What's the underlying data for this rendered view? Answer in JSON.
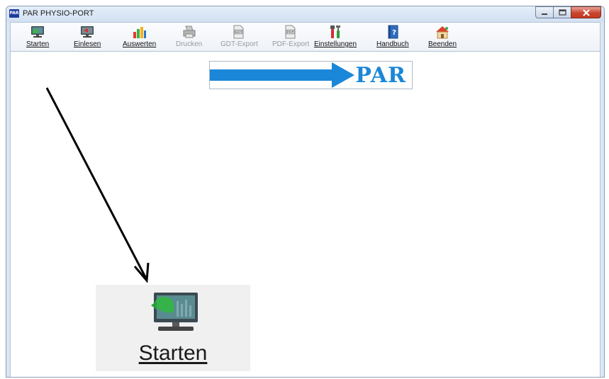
{
  "window": {
    "title": "PAR  PHYSIO-PORT",
    "app_icon_text": "PAR"
  },
  "toolbar": {
    "items": [
      {
        "label": "Starten",
        "icon": "monitor-start-icon",
        "enabled": true
      },
      {
        "label": "Einlesen",
        "icon": "monitor-read-icon",
        "enabled": true
      },
      {
        "label": "Auswerten",
        "icon": "bar-chart-icon",
        "enabled": true
      },
      {
        "label": "Drucken",
        "icon": "printer-icon",
        "enabled": false
      },
      {
        "label": "GDT-Export",
        "icon": "gdt-export-icon",
        "enabled": false
      },
      {
        "label": "PDF-Export",
        "icon": "pdf-export-icon",
        "enabled": false
      },
      {
        "label": "Einstellungen",
        "icon": "tools-icon",
        "enabled": true
      },
      {
        "label": "Handbuch",
        "icon": "manual-book-icon",
        "enabled": true
      },
      {
        "label": "Beenden",
        "icon": "home-exit-icon",
        "enabled": true
      }
    ]
  },
  "logo": {
    "text": "PAR",
    "color": "#1a87d8"
  },
  "callout": {
    "label": "Starten",
    "icon": "monitor-start-icon"
  },
  "colors": {
    "brand_blue": "#1a87d8",
    "disabled_text": "#9a9a9a"
  }
}
